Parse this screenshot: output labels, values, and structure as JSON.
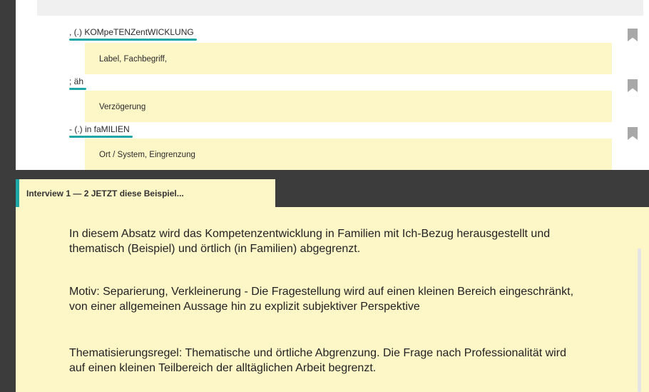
{
  "transcript": {
    "segments": [
      {
        "text": ", (.) KOMpeTENZentWICKLUNG",
        "code": "Label, Fachbegriff,"
      },
      {
        "text": "; äh",
        "code": "Verzögerung"
      },
      {
        "text": "- (.) in faMILIEN",
        "code": "Ort / System, Eingrenzung"
      }
    ]
  },
  "tab": {
    "title": "Interview 1 — 2 JETZT diese Beispiel..."
  },
  "memo": {
    "paragraphs": [
      "In diesem Absatz wird das Kompetenzentwicklung in Familien mit Ich-Bezug herausgestellt und thematisch (Beispiel) und örtlich (in Familien) abgegrenzt.",
      "Motiv: Separierung, Verkleinerung - Die Fragestellung wird auf einen kleinen Bereich eingeschränkt, von einer allgemeinen Aussage hin zu explizit subjektiver Perspektive",
      "Thematisierungsregel: Thematische und örtliche Abgrenzung. Die Frage nach Professionalität wird auf einen kleinen Teilbereich der alltäglichen Arbeit begrenzt."
    ]
  },
  "colors": {
    "accent": "#1fa7a7",
    "highlight": "#fdf6c7",
    "dark": "#3c3c3c",
    "bookmark": "#a8a8a8"
  }
}
